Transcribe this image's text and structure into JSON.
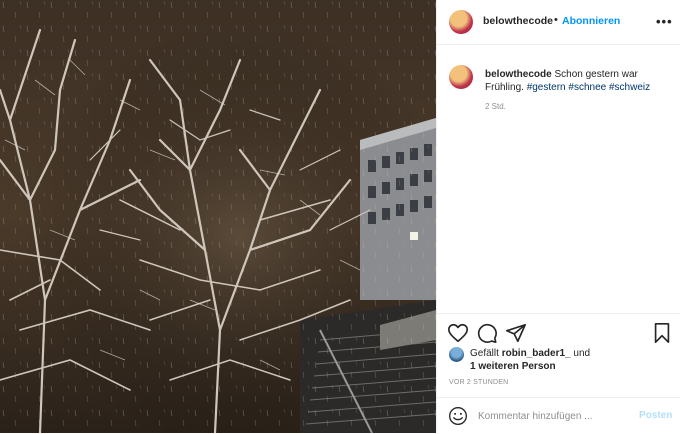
{
  "post": {
    "image_alt": "Verschneite Bäume bei Nacht neben einem Gebäude",
    "username": "belowthecode",
    "separator": "•",
    "follow_label": "Abonnieren",
    "more_label": "•••",
    "caption": {
      "username": "belowthecode",
      "text": "Schon gestern war Frühling.",
      "tags": [
        "#gestern",
        "#schnee",
        "#schweiz"
      ]
    },
    "relative_time": "2 Std.",
    "likes": {
      "prefix": "Gefällt",
      "user": "robin_bader1_",
      "connector": "und",
      "others": "1 weiteren Person"
    },
    "posted": "VOR 2 STUNDEN",
    "comment": {
      "placeholder": "Kommentar hinzufügen ...",
      "post_label": "Posten"
    },
    "icons": [
      "heart-icon",
      "comment-icon",
      "share-icon",
      "bookmark-icon",
      "emoji-icon",
      "more-icon"
    ],
    "colors": {
      "link": "#0095f6",
      "hashtag": "#00376b",
      "muted": "#8e8e8e",
      "post_disabled": "#b2dffc"
    }
  }
}
